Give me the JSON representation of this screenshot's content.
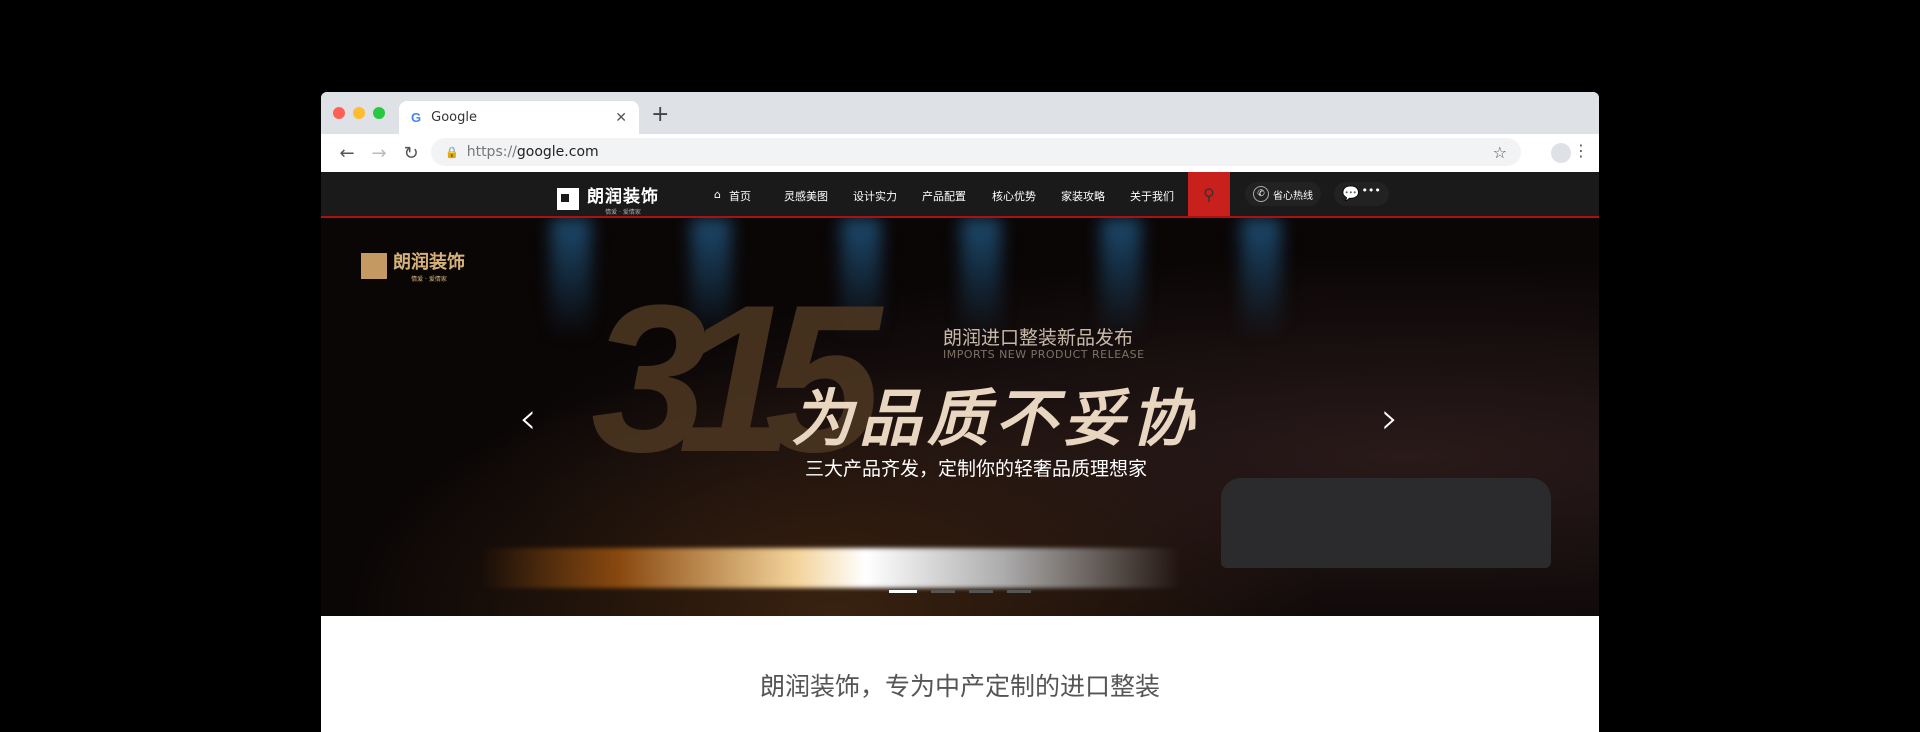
{
  "browser": {
    "tab_title": "Google",
    "tab_icon": "G",
    "url_protocol": "https://",
    "url_host": "google.com"
  },
  "nav": {
    "logo_title": "朗润装饰",
    "logo_sub": "情爱 · 爱情家",
    "items": [
      "首页",
      "灵感美图",
      "设计实力",
      "产品配置",
      "核心优势",
      "家装攻略",
      "关于我们"
    ],
    "hotline": "省心热线",
    "more": "•••"
  },
  "banner": {
    "logo_title": "朗润装饰",
    "logo_sub": "情爱 · 爱情家",
    "number": "315",
    "subtitle": "朗润进口整装新品发布",
    "subtitle_en": "IMPORTS NEW PRODUCT RELEASE",
    "headline": "为品质不妥协",
    "tagline": "三大产品齐发，定制你的轻奢品质理想家",
    "slides": 4,
    "active_slide": 1
  },
  "intro": {
    "heading": "朗润装饰，专为中产定制的进口整装"
  }
}
